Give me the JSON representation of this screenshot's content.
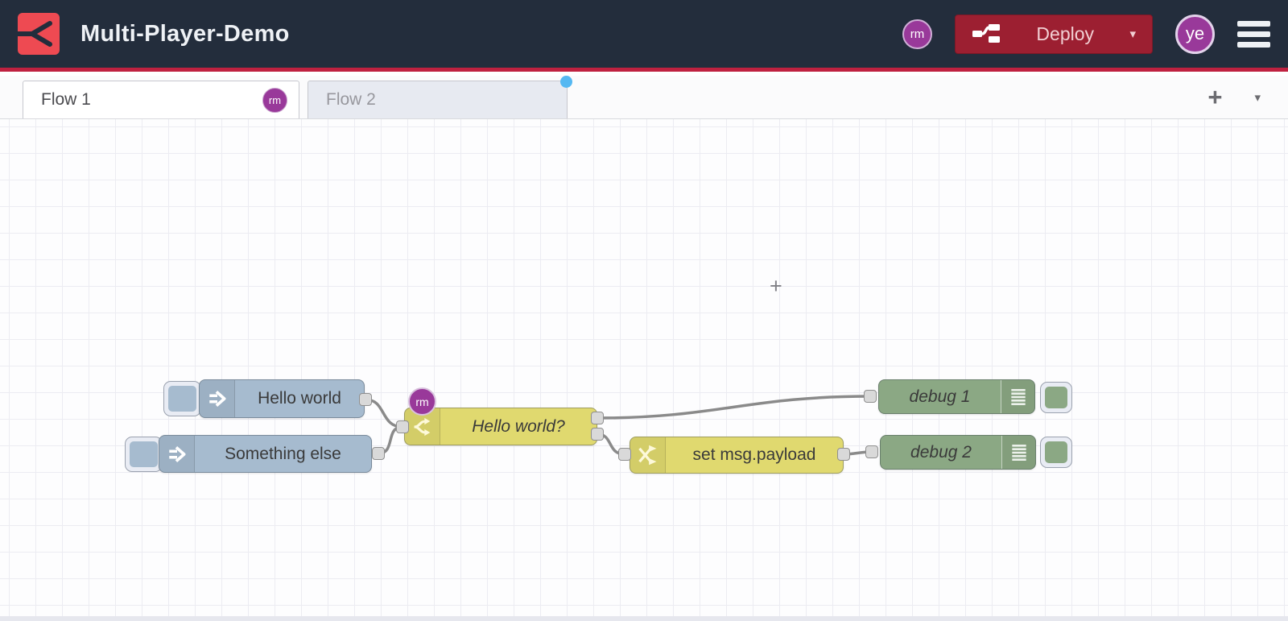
{
  "header": {
    "title": "Multi-Player-Demo",
    "collaborator_badge": "rm",
    "deploy": {
      "label": "Deploy",
      "caret": "▾"
    },
    "user_badge": "ye"
  },
  "tabbar": {
    "tabs": [
      {
        "label": "Flow 1",
        "badge": "rm",
        "active": true
      },
      {
        "label": "Flow 2",
        "active": false,
        "has_activity_dot": true
      }
    ],
    "add_label": "+",
    "list_caret": "▾"
  },
  "canvas": {
    "cursor_glyph": "+",
    "nodes": {
      "inject1": {
        "type": "inject",
        "label": "Hello world"
      },
      "inject2": {
        "type": "inject",
        "label": "Something else"
      },
      "switch1": {
        "type": "switch",
        "label": "Hello world?",
        "editing_badge": "rm"
      },
      "change1": {
        "type": "change",
        "label": "set msg.payload"
      },
      "debug1": {
        "type": "debug",
        "label": "debug 1"
      },
      "debug2": {
        "type": "debug",
        "label": "debug 2"
      }
    },
    "icons": [
      "inject-arrow-icon",
      "switch-fork-icon",
      "change-shuffle-icon",
      "debug-list-icon"
    ]
  },
  "colors": {
    "header_bg": "#232d3c",
    "accent_red": "#bf2140",
    "logo_red": "#ee4a52",
    "deploy_red": "#9c1f31",
    "avatar_purple": "#99399a",
    "node_inject_blue": "#a6bbcf",
    "node_function_yellow": "#e0d96f",
    "node_debug_green": "#8ba884",
    "wire_gray": "#8a8a8a",
    "tab_inactive_bg": "#e7eaf1",
    "activity_dot_blue": "#55b8f2"
  }
}
